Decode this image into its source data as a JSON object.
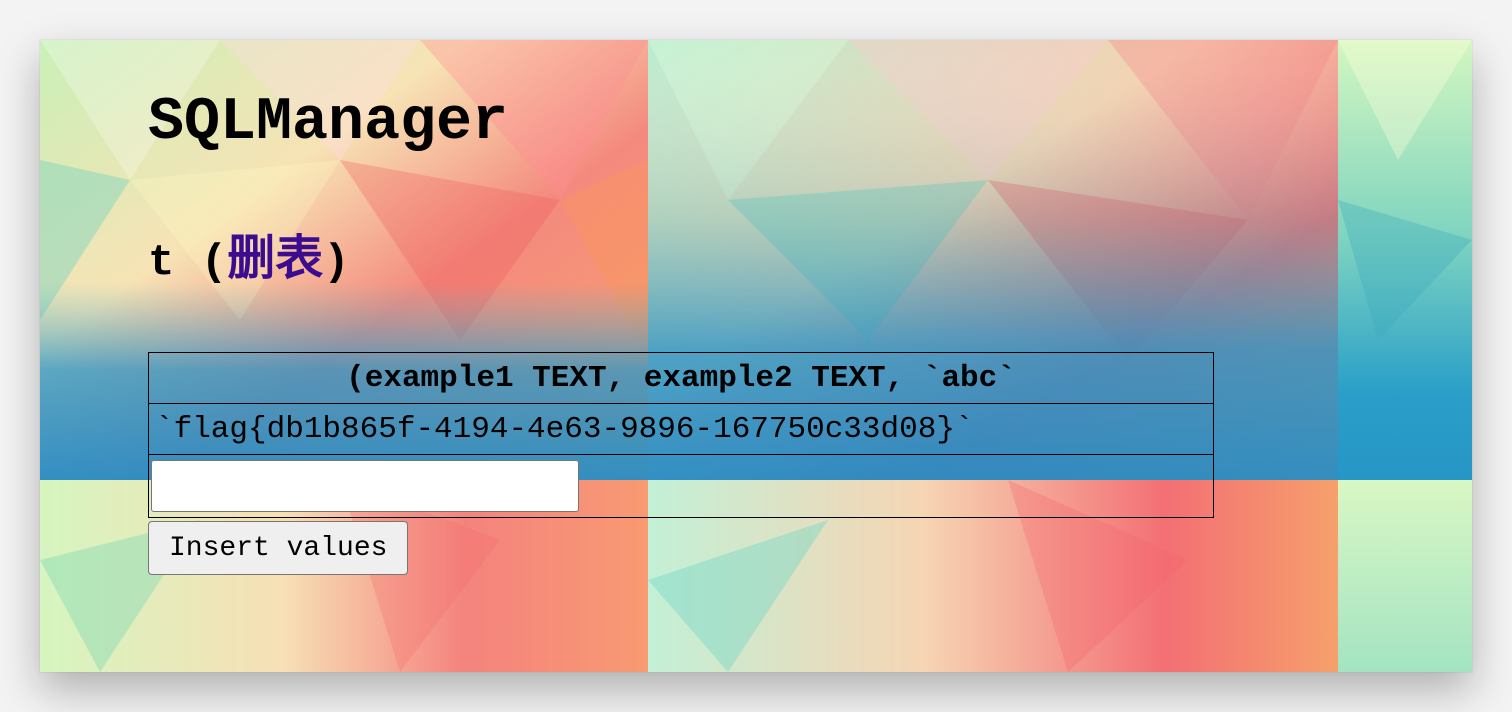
{
  "header": {
    "app_title": "SQLManager"
  },
  "table_section": {
    "table_name": "t",
    "paren_open": " (",
    "drop_link_label": "删表",
    "paren_close": ")"
  },
  "data_table": {
    "column_header": "(example1 TEXT, example2 TEXT, `abc`",
    "rows": [
      "`flag{db1b865f-4194-4e63-9896-167750c33d08}`"
    ],
    "input_value": ""
  },
  "actions": {
    "insert_label": "Insert values"
  },
  "colors": {
    "link": "#3b0c8f",
    "page_bg": "#f3f3f3"
  }
}
